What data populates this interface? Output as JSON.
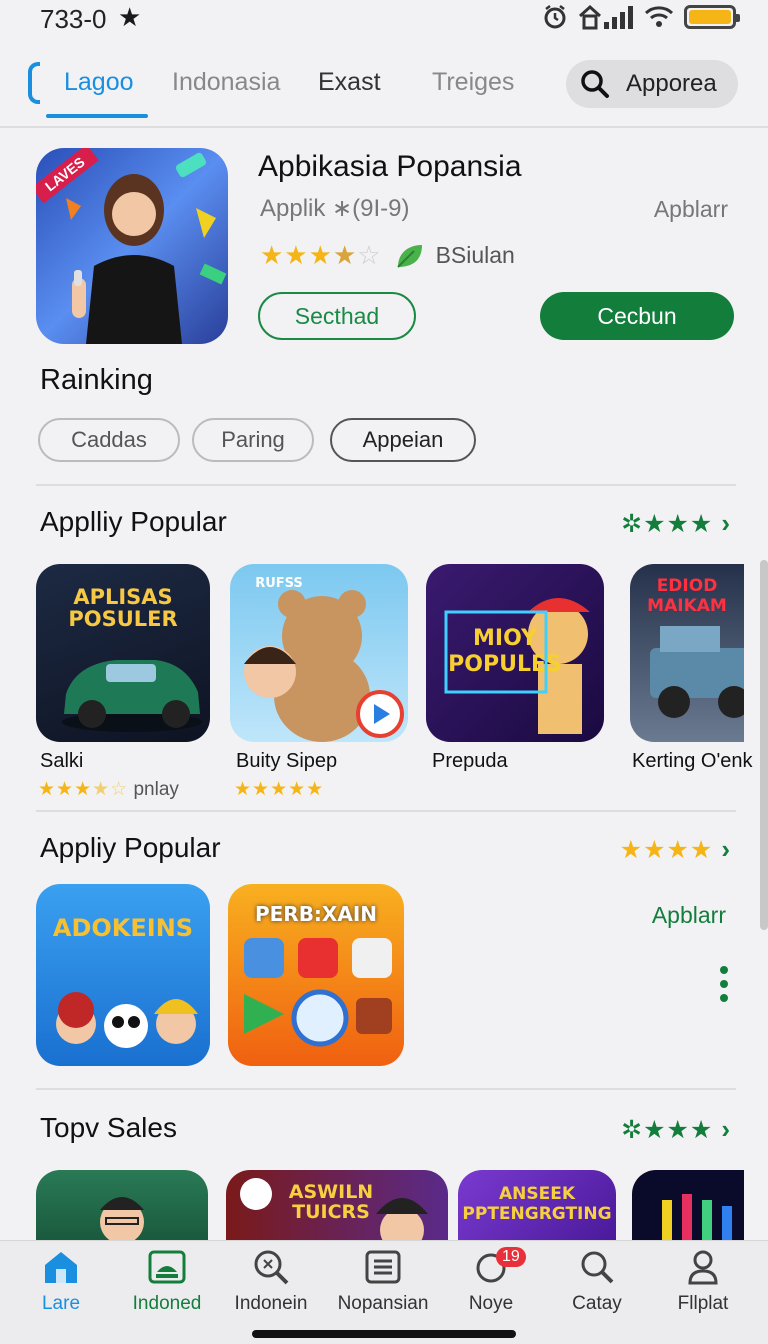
{
  "status": {
    "time": "733-0",
    "star": "★"
  },
  "tabs": [
    {
      "label": "Lagoo"
    },
    {
      "label": "Indonasia"
    },
    {
      "label": "Exast"
    },
    {
      "label": "Treiges"
    }
  ],
  "search": {
    "label": "Apporea"
  },
  "featured": {
    "title": "Apbikasia Popansia",
    "subtitle": "Applik ∗(9I-9)",
    "side_label": "Apblarr",
    "tag": "BSiulan",
    "icon_banner": "LAVES",
    "secondary_button": "Secthad",
    "primary_button": "Cecbun"
  },
  "ranking": {
    "title": "Rainking",
    "chips": [
      "Caddas",
      "Paring",
      "Appeian"
    ]
  },
  "sections": [
    {
      "title": "Applliy Popular",
      "apps": [
        {
          "name": "Salki",
          "rating_text": "pnlay",
          "icon_text": "APLISAS POSULER"
        },
        {
          "name": "Buity Sipep",
          "icon_text": "RUFSS"
        },
        {
          "name": "Prepuda",
          "icon_text": "MIOY POPULES"
        },
        {
          "name": "Kerting O'enk",
          "icon_text": "EDIOD MAIKAM"
        }
      ]
    },
    {
      "title": "Appliy Popular",
      "link": "Apblarr",
      "apps": [
        {
          "icon_text": "ADOKEINS"
        },
        {
          "icon_text": "PERB:XAIN"
        }
      ]
    },
    {
      "title": "Topv Sales",
      "apps": [
        {
          "icon_text": ""
        },
        {
          "icon_text": "ASWILN TUICRS"
        },
        {
          "icon_text": "ANSEEK PPTENGRGTING"
        },
        {
          "icon_text": ""
        }
      ]
    }
  ],
  "bottom_nav": [
    {
      "label": "Lare"
    },
    {
      "label": "Indoned"
    },
    {
      "label": "Indonein"
    },
    {
      "label": "Nopansian"
    },
    {
      "label": "Noye",
      "badge": "19"
    },
    {
      "label": "Catay"
    },
    {
      "label": "Fllplat"
    }
  ],
  "colors": {
    "accent_blue": "#1a8fe0",
    "accent_green": "#137e3c",
    "star": "#f5b517"
  }
}
